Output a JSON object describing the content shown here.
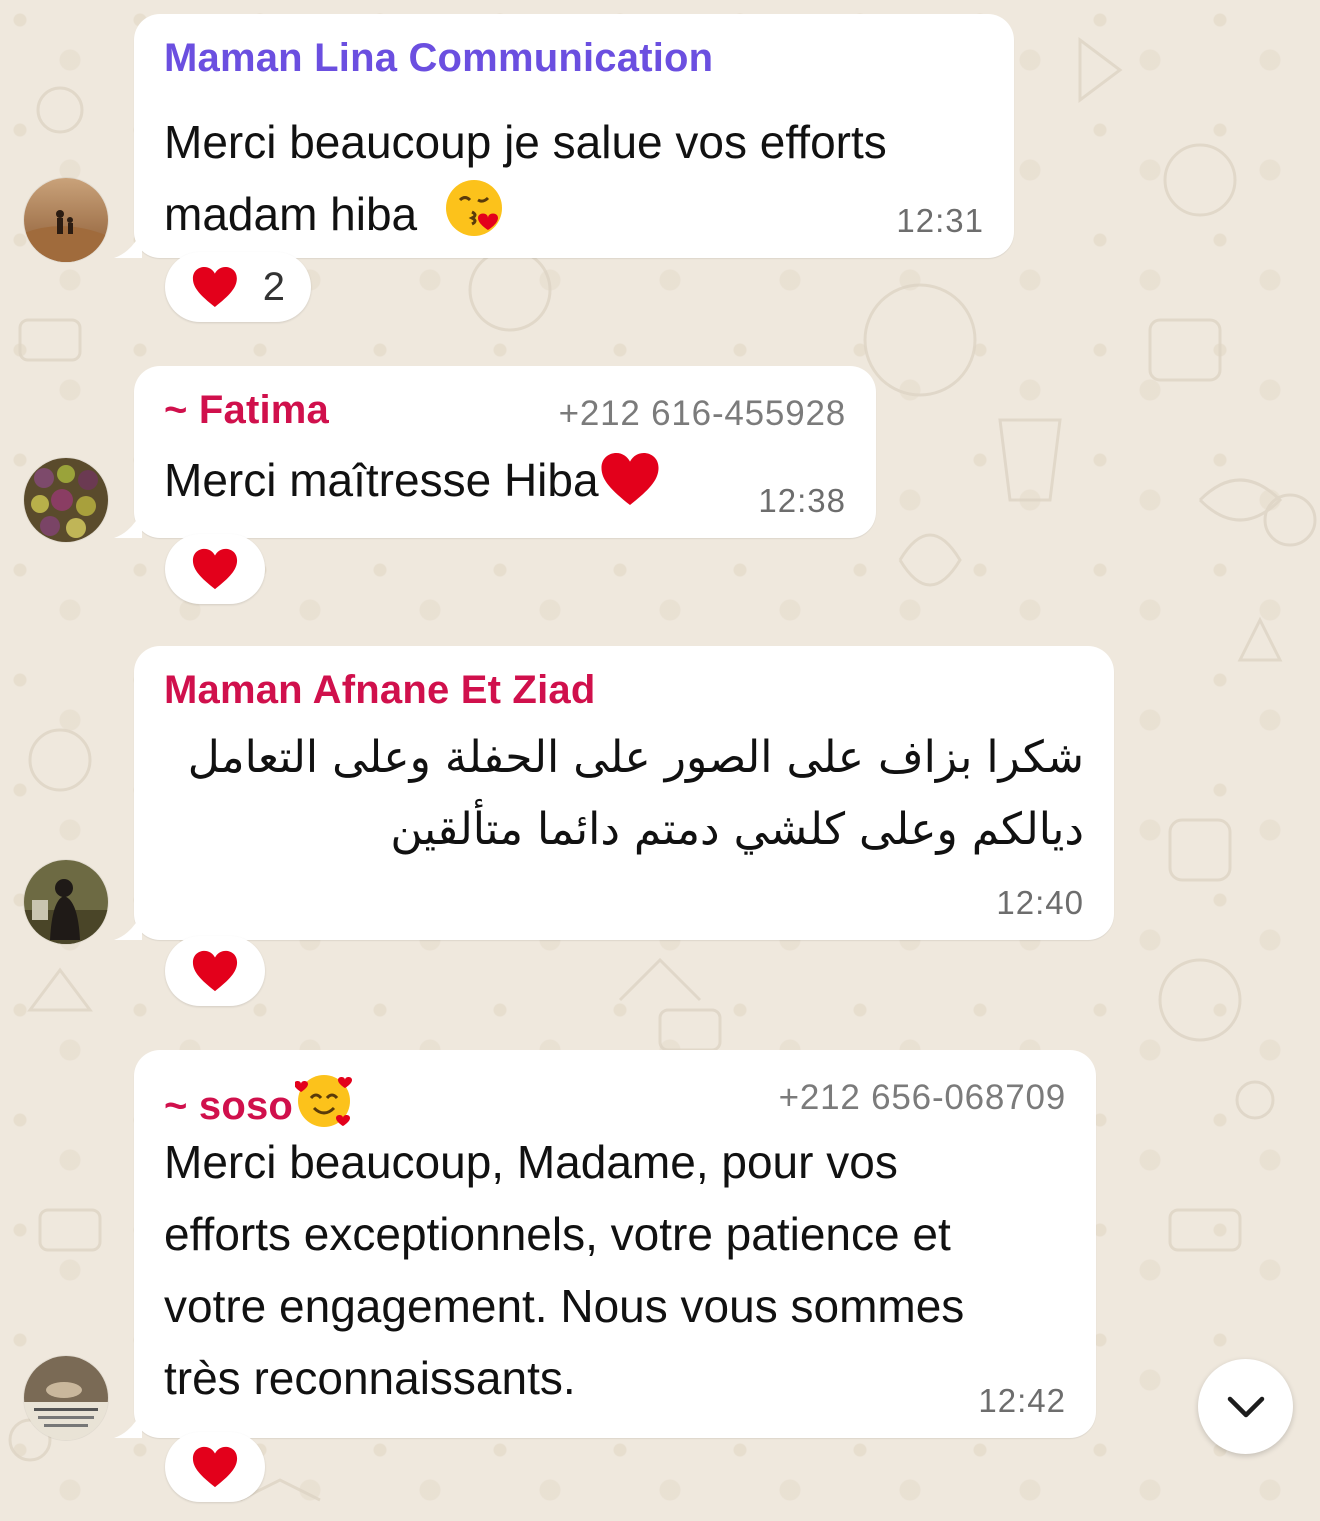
{
  "colors": {
    "background": "#efe8dd",
    "bubble": "#ffffff",
    "sender_lina": "#6b4fe0",
    "sender_red": "#d0104c",
    "heart": "#e3001b"
  },
  "messages": [
    {
      "sender": "Maman Lina Communication",
      "phone": "",
      "lines": [
        "Merci beaucoup je salue vos efforts",
        "madam hiba"
      ],
      "emoji": "face-blowing-kiss",
      "time": "12:31",
      "reaction": {
        "icon": "red-heart",
        "count": "2"
      }
    },
    {
      "sender": "~ Fatima",
      "phone": "+212 616-455928",
      "lines": [
        "Merci maîtresse Hiba"
      ],
      "emoji": "red-heart",
      "time": "12:38",
      "reaction": {
        "icon": "red-heart",
        "count": ""
      }
    },
    {
      "sender": "Maman Afnane Et Ziad",
      "phone": "",
      "lines": [
        "شكرا بزاف على الصور على الحفلة وعلى التعامل",
        "ديالكم وعلى كلشي دمتم دائما متألقين"
      ],
      "emoji": "",
      "time": "12:40",
      "reaction": {
        "icon": "red-heart",
        "count": ""
      }
    },
    {
      "sender": "~ soso",
      "phone": "+212 656-068709",
      "lines": [
        "Merci beaucoup, Madame, pour vos",
        "efforts exceptionnels, votre patience et",
        "votre engagement. Nous vous sommes",
        "très reconnaissants."
      ],
      "emoji": "smiling-face-with-hearts",
      "time": "12:42",
      "reaction": {
        "icon": "red-heart",
        "count": ""
      }
    }
  ],
  "scroll_button": {
    "icon": "chevron-down-icon"
  }
}
